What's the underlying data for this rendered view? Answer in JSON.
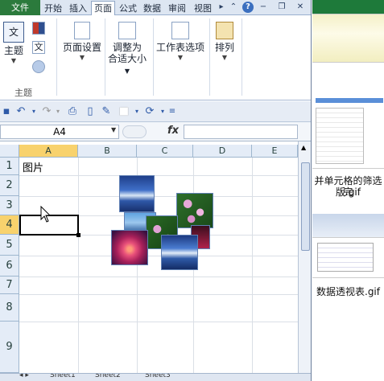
{
  "ribbon": {
    "tabs": [
      "文件",
      "开始",
      "插入",
      "页面",
      "公式",
      "数据",
      "审阅",
      "视图"
    ],
    "active_tab": "页面",
    "buttons": {
      "theme": "主题",
      "page_setup": "页面设置",
      "fit_1": "调整为",
      "fit_2": "合适大小",
      "sheet_options": "工作表选项",
      "arrange": "排列"
    },
    "group_theme": "主题",
    "help": "?"
  },
  "formula_bar": {
    "name_box": "A4",
    "fx": "fx",
    "formula": ""
  },
  "sheet": {
    "columns": [
      "A",
      "B",
      "C",
      "D",
      "E"
    ],
    "rows": [
      "1",
      "2",
      "3",
      "4",
      "5",
      "6",
      "7",
      "8",
      "9"
    ],
    "cell_a1": "图片",
    "active_cell": "A4"
  },
  "sheet_tabs": [
    "Sheet1",
    "Sheet2",
    "Sheet3"
  ],
  "side_panel": {
    "caption1_a": "并单元格的筛选完",
    "caption1_b": "版.gif",
    "caption2": "数据透视表.gif"
  },
  "colors": {
    "file_tab": "#2b7a3c",
    "active_header": "#f8d26d",
    "header_bg": "#e4ecf7"
  }
}
